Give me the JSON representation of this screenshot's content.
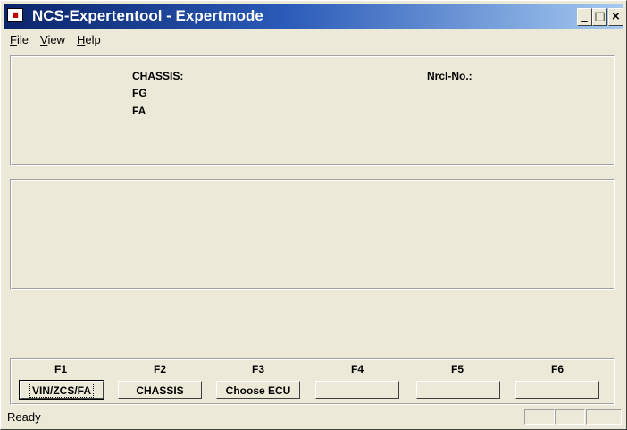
{
  "window": {
    "title": "NCS-Expertentool - Expertmode",
    "icon": "app-icon"
  },
  "title_controls": {
    "minimize": "_",
    "maximize": "□",
    "close": "×"
  },
  "menu": [
    {
      "label": "File",
      "underline": "F",
      "rest": "ile"
    },
    {
      "label": "View",
      "underline": "V",
      "rest": "iew"
    },
    {
      "label": "Help",
      "underline": "H",
      "rest": "elp"
    }
  ],
  "info_panel": {
    "chassis_label": "CHASSIS:",
    "fg_label": "FG",
    "fa_label": "FA",
    "nrcl_label": "Nrcl-No.:"
  },
  "function_keys": [
    {
      "key": "F1",
      "label": "VIN/ZCS/FA"
    },
    {
      "key": "F2",
      "label": "CHASSIS"
    },
    {
      "key": "F3",
      "label": "Choose ECU"
    },
    {
      "key": "F4",
      "label": ""
    },
    {
      "key": "F5",
      "label": ""
    },
    {
      "key": "F6",
      "label": ""
    }
  ],
  "status": {
    "text": "Ready"
  }
}
